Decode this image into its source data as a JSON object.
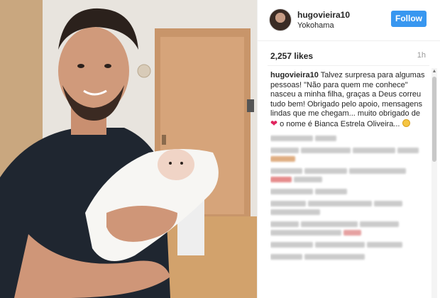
{
  "post": {
    "username": "hugovieira10",
    "location": "Yokohama",
    "follow_label": "Follow",
    "likes": "2,257 likes",
    "time": "1h",
    "caption_user": "hugovieira10",
    "caption_part1": " Talvez surpresa para algumas pessoas! \"Não para quem me conhece\" nasceu a minha filha, graças a Deus correu tudo bem! Obrigado pelo apoio, mensagens lindas que me chegam... muito obrigado de ",
    "caption_part2": " o nome é Bianca Estrela Oliveira... ",
    "heart_glyph": "❤"
  },
  "colors": {
    "follow_button": "#3897f0",
    "heart": "#e0245e"
  },
  "icons": [
    "heart-icon",
    "smiley-emoji-icon",
    "scroll-up-icon"
  ]
}
